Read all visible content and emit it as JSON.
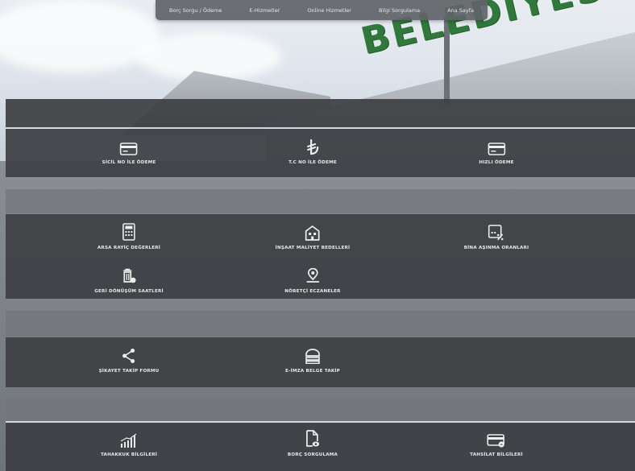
{
  "nav": {
    "items": [
      "Borç Sorgu / Ödeme",
      "E-Hizmetler",
      "Online Hizmetler",
      "Bilgi Sorgulama",
      "Ana Sayfa"
    ]
  },
  "building_sign": "BELEDİYESİ",
  "sections": {
    "payments": [
      {
        "label": "SİCİL NO İLE ÖDEME",
        "icon": "card-icon"
      },
      {
        "label": "T.C NO İLE ÖDEME",
        "icon": "lira-icon"
      },
      {
        "label": "HIZLI ÖDEME",
        "icon": "card-icon"
      }
    ],
    "info_row1": [
      {
        "label": "ARSA RAYİÇ DEĞERLERİ",
        "icon": "calculator-icon"
      },
      {
        "label": "İNŞAAT MALİYET BEDELLERİ",
        "icon": "building-icon"
      },
      {
        "label": "BİNA AŞINMA ORANLARI",
        "icon": "percent-icon"
      }
    ],
    "info_row2": [
      {
        "label": "GERİ DÖNÜŞÜM SAATLERİ",
        "icon": "recycle-bin-icon"
      },
      {
        "label": "NÖBETÇİ ECZANELER",
        "icon": "map-pin-icon"
      }
    ],
    "services": [
      {
        "label": "ŞİKAYET TAKİP FORMU",
        "icon": "share-icon"
      },
      {
        "label": "E-İMZA BELGE TAKİP",
        "icon": "stack-icon"
      }
    ],
    "accounts": [
      {
        "label": "TAHAKKUK BİLGİLERİ",
        "icon": "bar-chart-icon"
      },
      {
        "label": "BORÇ SORGULAMA",
        "icon": "document-search-icon"
      },
      {
        "label": "TAHSİLAT BİLGİLERİ",
        "icon": "credit-card-icon"
      }
    ]
  },
  "colors": {
    "panel_dark": "#3e4044",
    "text": "#e9e9e9",
    "sign_green": "#2f7a3a"
  }
}
